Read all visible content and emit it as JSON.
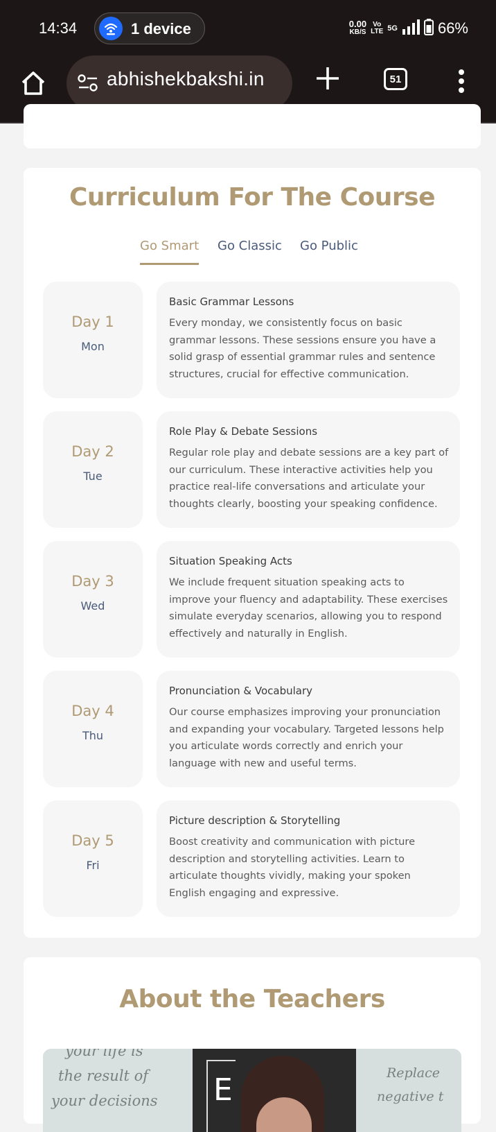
{
  "status_bar": {
    "time": "14:34",
    "hotspot_label": "1 device",
    "speed_value": "0.00",
    "speed_unit": "KB/S",
    "volte_top": "Vo",
    "volte_bottom": "LTE",
    "network": "5G",
    "battery": "66%"
  },
  "browser": {
    "url": "abhishekbakshi.in",
    "tab_count": "51"
  },
  "curriculum": {
    "title": "Curriculum For The Course",
    "tabs": [
      "Go Smart",
      "Go Classic",
      "Go Public"
    ],
    "active_tab": "Go Smart",
    "days": [
      {
        "day": "Day 1",
        "short": "Mon",
        "title": "Basic Grammar Lessons",
        "text": "Every monday, we consistently focus on basic grammar lessons. These sessions ensure you have a solid grasp of essential grammar rules and sentence structures, crucial for effective communication."
      },
      {
        "day": "Day 2",
        "short": "Tue",
        "title": "Role Play & Debate Sessions",
        "text": "Regular role play and debate sessions are a key part of our curriculum. These interactive activities help you practice real-life conversations and articulate your thoughts clearly, boosting your speaking confidence."
      },
      {
        "day": "Day 3",
        "short": "Wed",
        "title": "Situation Speaking Acts",
        "text": "We include frequent situation speaking acts to improve your fluency and adaptability. These exercises simulate everyday scenarios, allowing you to respond effectively and naturally in English."
      },
      {
        "day": "Day 4",
        "short": "Thu",
        "title": "Pronunciation & Vocabulary",
        "text": "Our course emphasizes improving your pronunciation and expanding your vocabulary. Targeted lessons help you articulate words correctly and enrich your language with new and useful terms."
      },
      {
        "day": "Day 5",
        "short": "Fri",
        "title": "Picture description & Storytelling",
        "text": "Boost creativity and communication with picture description and storytelling activities. Learn to articulate thoughts vividly, making your spoken English engaging and expressive."
      }
    ]
  },
  "about": {
    "title": "About the Teachers",
    "image_text_left": [
      "your life is",
      "the result of",
      "your decisions"
    ],
    "image_letter": "E",
    "image_text_right": [
      "Replace",
      "negative t"
    ]
  },
  "colors": {
    "accent": "#b09a74",
    "navy_text": "#4a5a7a",
    "statusbar_bg": "#1d1616"
  }
}
